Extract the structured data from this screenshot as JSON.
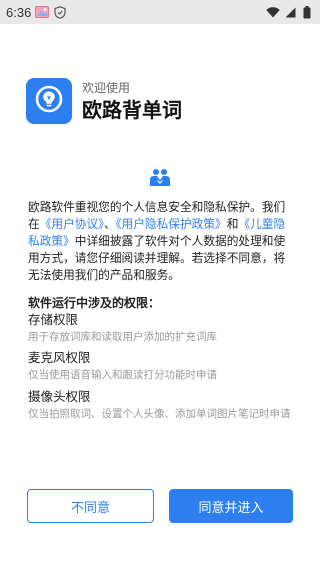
{
  "status_bar": {
    "time": "6:36",
    "icons": [
      "photo-icon",
      "shield-icon",
      "wifi-icon",
      "signal-icon",
      "battery-icon"
    ]
  },
  "header": {
    "welcome": "欢迎使用",
    "app_name": "欧路背单词",
    "logo_icon": "lightbulb-icon"
  },
  "intro": {
    "part1": "欧路软件重视您的个人信息安全和隐私保护。我们在",
    "link1": "《用户协议》",
    "sep1": "、",
    "link2": "《用户隐私保护政策》",
    "sep2": "和",
    "link3": "《儿童隐私政策》",
    "part2": "中详细披露了软件对个人数据的处理和使用方式，请您仔细阅读并理解。若选择不同意，将无法使用我们的产品和服务。"
  },
  "permissions": {
    "title": "软件运行中涉及的权限：",
    "items": [
      {
        "name": "存储权限",
        "desc": "用于存放词库和读取用户添加的扩充词库"
      },
      {
        "name": "麦克风权限",
        "desc": "仅当使用语音输入和跟读打分功能时申请"
      },
      {
        "name": "摄像头权限",
        "desc": "仅当拍照取词、设置个人头像、添加单词图片笔记时申请"
      }
    ]
  },
  "buttons": {
    "decline": "不同意",
    "accept": "同意并进入"
  },
  "colors": {
    "accent": "#2d7ff0",
    "link": "#2f7ff5",
    "muted": "#999999"
  }
}
